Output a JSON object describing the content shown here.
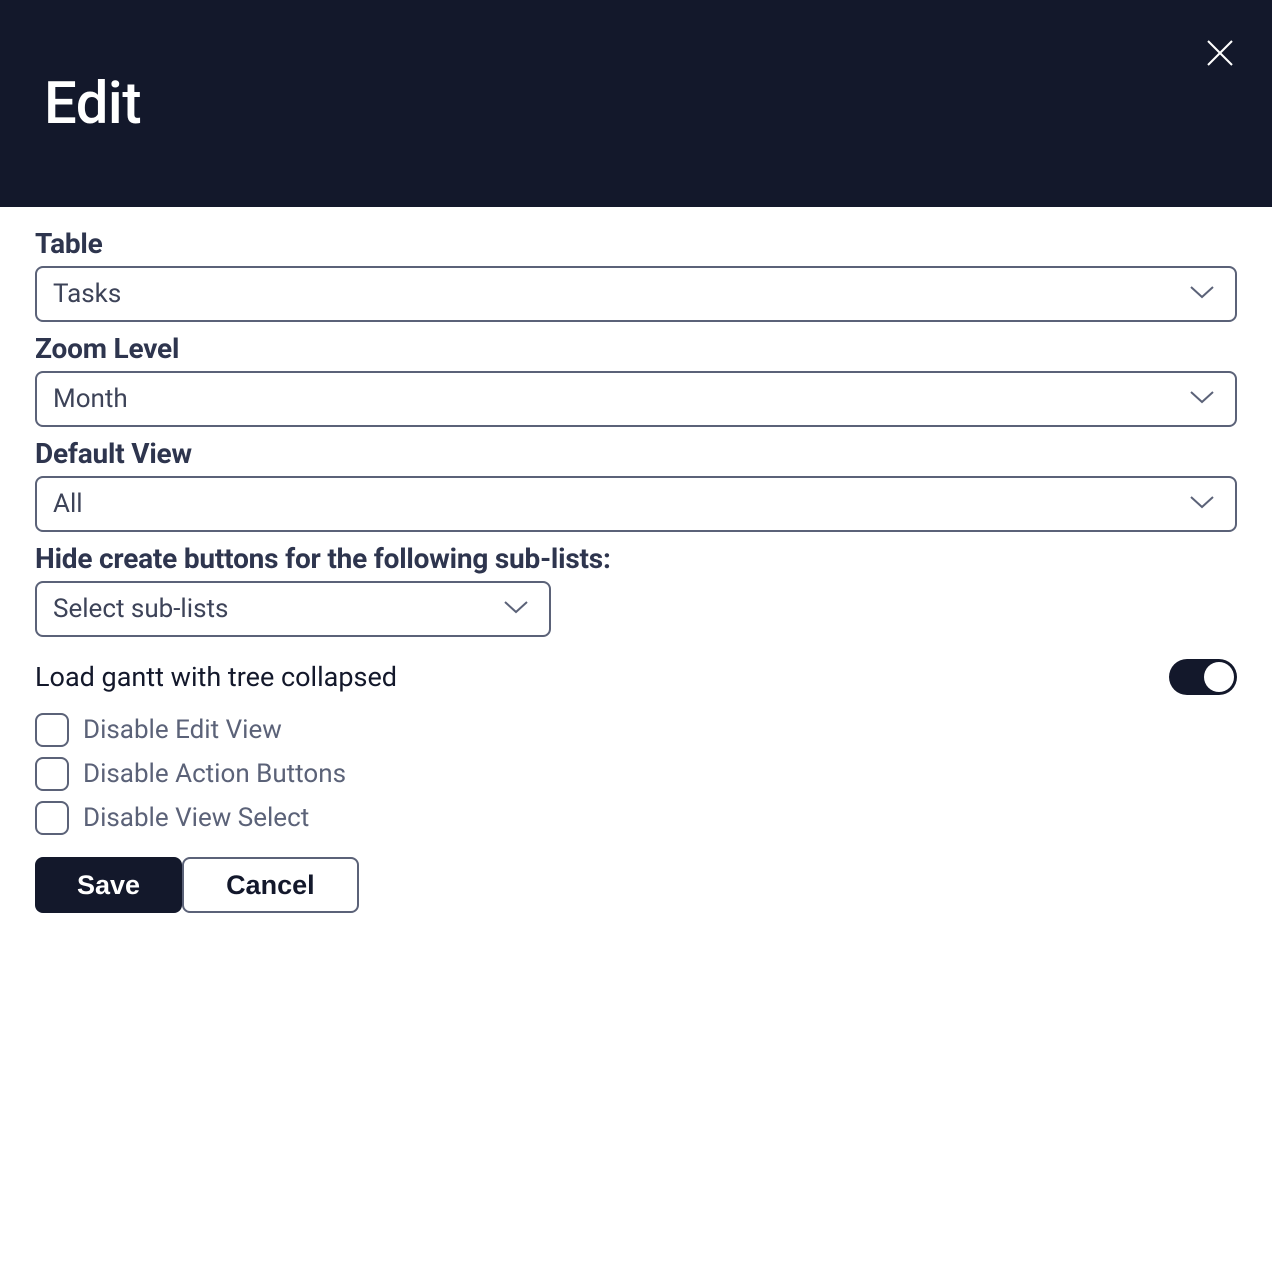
{
  "header": {
    "title": "Edit"
  },
  "fields": {
    "table": {
      "label": "Table",
      "value": "Tasks"
    },
    "zoom": {
      "label": "Zoom Level",
      "value": "Month"
    },
    "defaultView": {
      "label": "Default View",
      "value": "All"
    },
    "hideCreate": {
      "label": "Hide create buttons for the following sub-lists:",
      "placeholder": "Select sub-lists"
    }
  },
  "toggle": {
    "label": "Load gantt with tree collapsed",
    "on": true
  },
  "checkboxes": [
    {
      "label": "Disable Edit View",
      "checked": false
    },
    {
      "label": "Disable Action Buttons",
      "checked": false
    },
    {
      "label": "Disable View Select",
      "checked": false
    }
  ],
  "buttons": {
    "save": "Save",
    "cancel": "Cancel"
  }
}
